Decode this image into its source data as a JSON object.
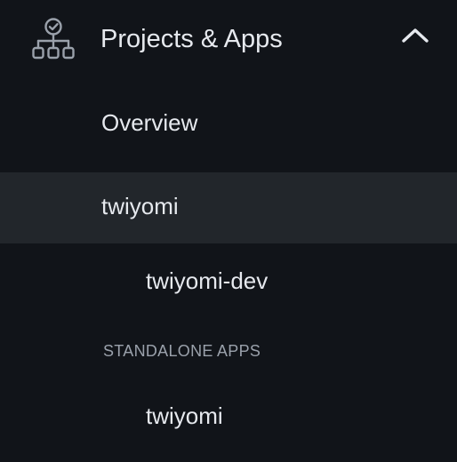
{
  "section": {
    "title": "Projects & Apps",
    "icon": "org-chart-icon",
    "toggle_icon": "chevron-up-icon",
    "expanded": true
  },
  "items": [
    {
      "label": "Overview",
      "active": false
    },
    {
      "label": "twiyomi",
      "active": true
    },
    {
      "label": "twiyomi-dev",
      "active": false
    }
  ],
  "standalone": {
    "heading": "STANDALONE APPS",
    "items": [
      {
        "label": "twiyomi",
        "active": false
      }
    ]
  },
  "colors": {
    "background": "#111419",
    "active_background": "#22262b",
    "text": "#e6e9ee",
    "muted_text": "#9aa1ab",
    "icon": "#9aa1ab"
  }
}
